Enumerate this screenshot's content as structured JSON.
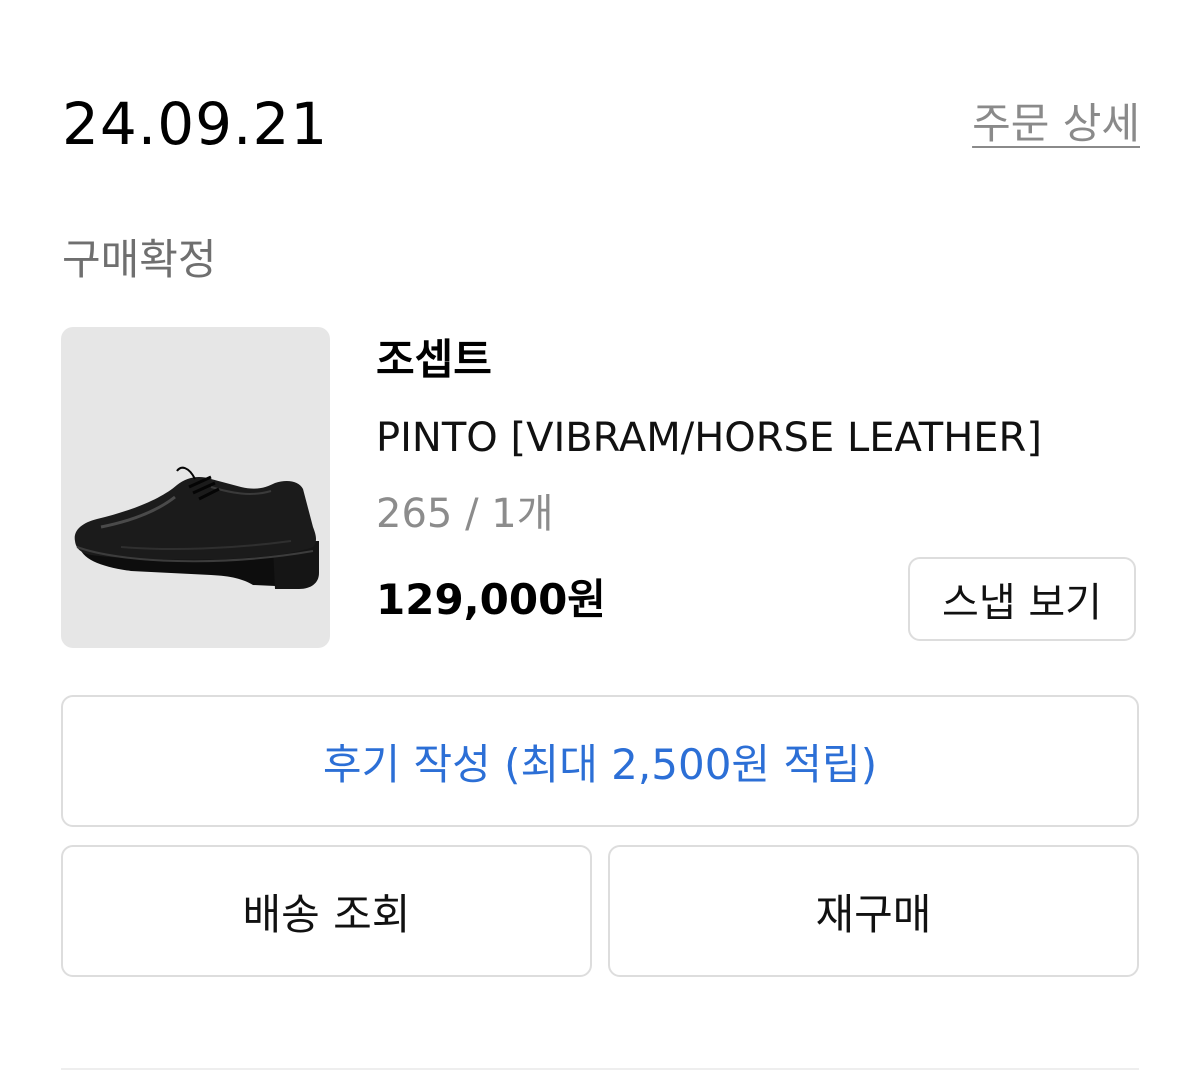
{
  "order": {
    "date": "24.09.21",
    "detail_link": "주문 상세",
    "status": "구매확정"
  },
  "product": {
    "brand": "조셉트",
    "name": "PINTO [VIBRAM/HORSE LEATHER]",
    "option": "265 / 1개",
    "price": "129,000원",
    "image_icon": "shoe-image",
    "thumb_bg": "#e6e6e6"
  },
  "buttons": {
    "snap": "스냅 보기",
    "review": "후기 작성 (최대 2,500원 적립)",
    "track": "배송 조회",
    "rebuy": "재구매"
  },
  "colors": {
    "accent": "#2c6fd6",
    "muted": "#8c8c8c",
    "border": "#dddddd"
  }
}
